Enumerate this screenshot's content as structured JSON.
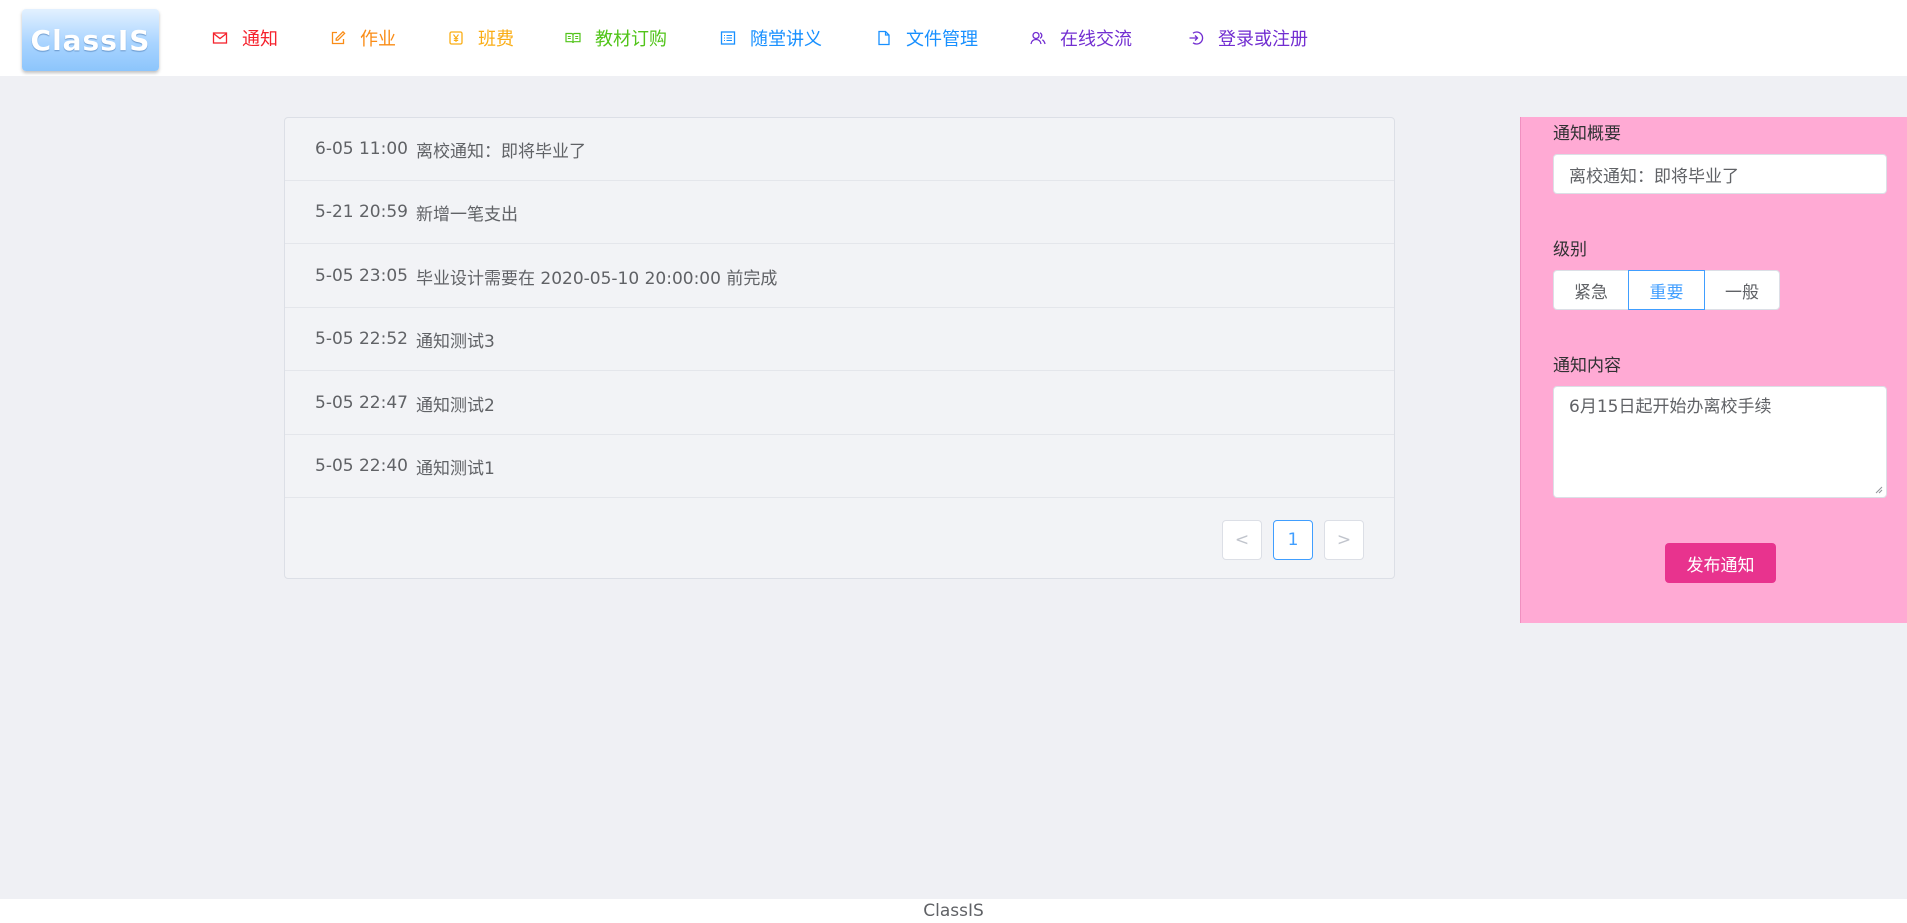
{
  "brand": {
    "logo_text": "ClassIS"
  },
  "nav": [
    {
      "label": "通知",
      "color": "#f5222d",
      "icon": "mail-icon"
    },
    {
      "label": "作业",
      "color": "#fa8c16",
      "icon": "edit-icon"
    },
    {
      "label": "班费",
      "color": "#faad14",
      "icon": "yen-icon"
    },
    {
      "label": "教材订购",
      "color": "#52c41a",
      "icon": "book-icon"
    },
    {
      "label": "随堂讲义",
      "color": "#1890ff",
      "icon": "list-icon"
    },
    {
      "label": "文件管理",
      "color": "#1890ff",
      "icon": "document-icon"
    },
    {
      "label": "在线交流",
      "color": "#722ed1",
      "icon": "users-icon"
    },
    {
      "label": "登录或注册",
      "color": "#722ed1",
      "icon": "login-icon"
    }
  ],
  "notifications": [
    {
      "time": "6-05 11:00",
      "title": "离校通知：即将毕业了"
    },
    {
      "time": "5-21 20:59",
      "title": "新增一笔支出"
    },
    {
      "time": "5-05 23:05",
      "title": "毕业设计需要在 2020-05-10 20:00:00 前完成"
    },
    {
      "time": "5-05 22:52",
      "title": "通知测试3"
    },
    {
      "time": "5-05 22:47",
      "title": "通知测试2"
    },
    {
      "time": "5-05 22:40",
      "title": "通知测试1"
    }
  ],
  "pagination": {
    "prev": "<",
    "current": "1",
    "next": ">"
  },
  "form": {
    "summary_label": "通知概要",
    "summary_value": "离校通知：即将毕业了",
    "level_label": "级别",
    "levels": [
      "紧急",
      "重要",
      "一般"
    ],
    "selected_level": "重要",
    "content_label": "通知内容",
    "content_value": "6月15日起开始办离校手续",
    "submit_label": "发布通知"
  },
  "footer": {
    "text": "ClassIS"
  },
  "colors": {
    "accent": "#409eff",
    "side_panel": "#ffaad4",
    "submit_button": "#e8338e",
    "page_bg": "#eff0f4"
  }
}
